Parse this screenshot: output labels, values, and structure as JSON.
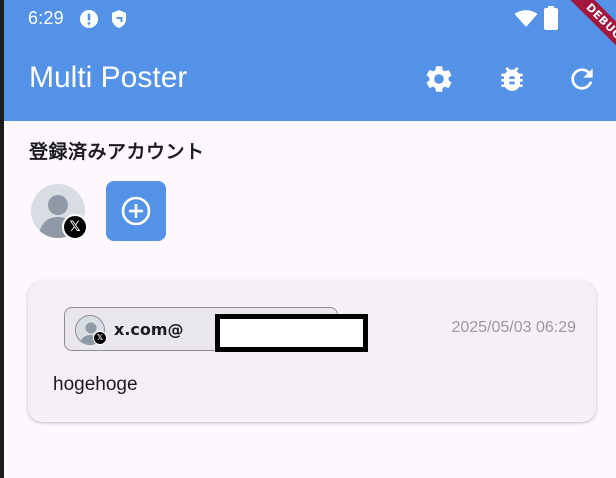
{
  "status_bar": {
    "time": "6:29",
    "icons": [
      "alert-circle-icon",
      "shield-icon",
      "wifi-icon",
      "battery-icon"
    ]
  },
  "debug_banner": "DEBUG",
  "app_bar": {
    "title": "Multi Poster",
    "actions": [
      "settings-icon",
      "bug-icon",
      "refresh-icon"
    ],
    "color": "#5392e6"
  },
  "accounts": {
    "title": "登録済みアカウント",
    "items": [
      {
        "service": "x",
        "badge_glyph": "𝕏"
      }
    ],
    "add_icon": "add-circle-icon"
  },
  "posts": [
    {
      "account_label": "x.com@",
      "badge_glyph": "𝕏",
      "timestamp": "2025/05/03 06:29",
      "text": "hogehoge"
    }
  ]
}
